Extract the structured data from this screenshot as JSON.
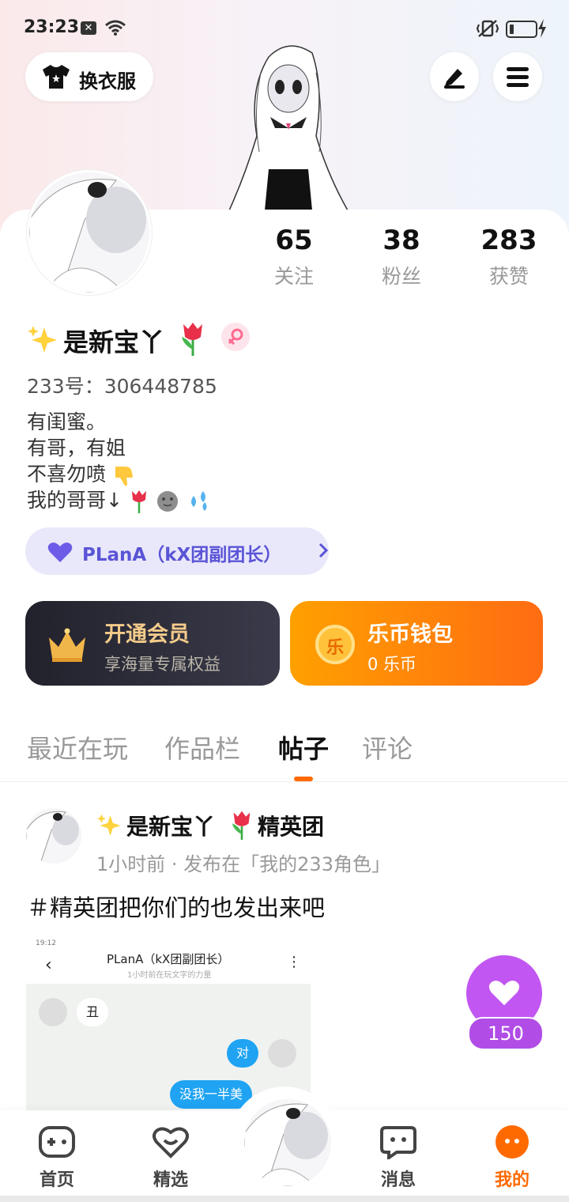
{
  "status_bar": {
    "time": "23:23",
    "x_badge": "✕"
  },
  "header": {
    "dress_label": "换衣服"
  },
  "stats": [
    {
      "value": "65",
      "label": "关注"
    },
    {
      "value": "38",
      "label": "粉丝"
    },
    {
      "value": "283",
      "label": "获赞"
    }
  ],
  "profile": {
    "name": "是新宝丫",
    "id_text": "233号：306448785",
    "bio": [
      "有闺蜜。",
      "有哥，有姐",
      "不喜勿喷",
      "我的哥哥↓"
    ]
  },
  "group_tag": {
    "label": "PLanA（kX团副团长）"
  },
  "vip_card": {
    "title": "开通会员",
    "subtitle": "享海量专属权益"
  },
  "coin_card": {
    "icon_char": "乐",
    "title": "乐币钱包",
    "subtitle": "0 乐币"
  },
  "tabs": [
    {
      "label": "最近在玩",
      "active": false
    },
    {
      "label": "作品栏",
      "active": false
    },
    {
      "label": "帖子",
      "active": true
    },
    {
      "label": "评论",
      "active": false
    }
  ],
  "post": {
    "author": "是新宝丫",
    "group": "精英团",
    "meta": "1小时前 · 发布在「我的233角色」",
    "text": "＃精英团把你们的也发出来吧",
    "screenshot": {
      "status": "19:12",
      "title": "PLanA（kX团副团长）",
      "subtitle": "1小时前在玩文字的力量",
      "messages": [
        "丑",
        "对",
        "没我一半美"
      ]
    },
    "likes": "150"
  },
  "nav": [
    {
      "label": "首页",
      "icon": "gamepad-icon"
    },
    {
      "label": "精选",
      "icon": "heart-smile-icon"
    },
    {
      "label": "",
      "icon": "avatar-center"
    },
    {
      "label": "消息",
      "icon": "chat-icon"
    },
    {
      "label": "我的",
      "icon": "profile-icon",
      "active": true
    }
  ],
  "colors": {
    "accent": "#ff6a00",
    "purple": "#c256f2",
    "gold": "#f3cb8a",
    "tag_text": "#5a54d6"
  }
}
